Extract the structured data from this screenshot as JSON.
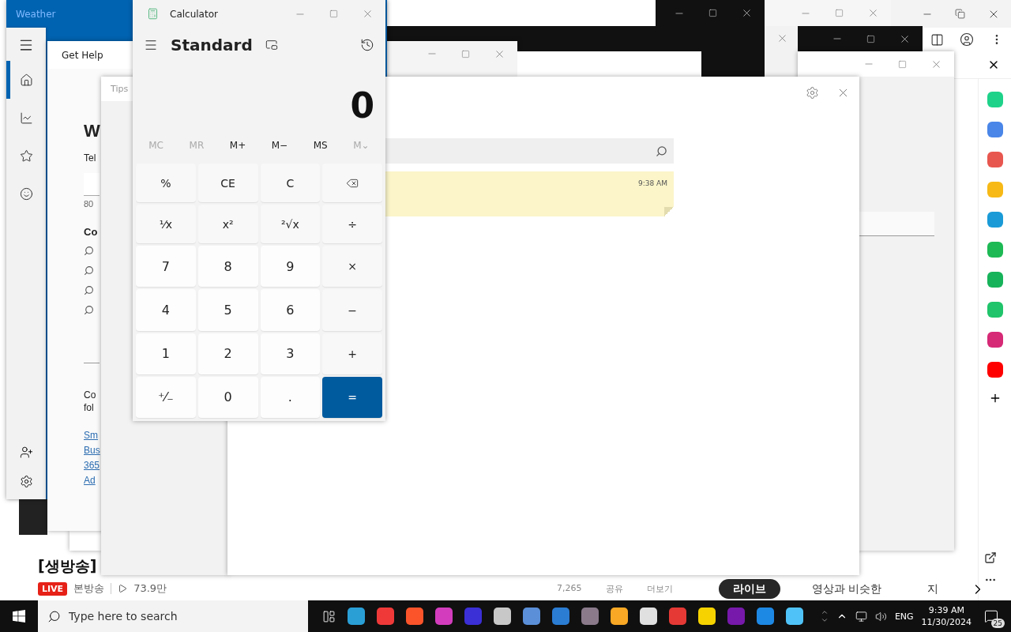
{
  "browser": {
    "video_title": "[생방송]",
    "live_badge": "LIVE",
    "channel": "본방송",
    "views": "73.9만",
    "likes": "7,265",
    "share": "공유",
    "more": "더보기",
    "chips": [
      {
        "label": "라이브",
        "selected": true
      },
      {
        "label": "영상과 비슷한",
        "selected": false
      },
      {
        "label": "지",
        "selected": false
      }
    ],
    "sidebar_apps": [
      {
        "color": "#1ed28a"
      },
      {
        "color": "#4a86e8"
      },
      {
        "color": "#e8574f"
      },
      {
        "color": "#f7b916"
      },
      {
        "color": "#1a9bd7"
      },
      {
        "color": "#1db954"
      },
      {
        "color": "#17b35a"
      },
      {
        "color": "#20c46a"
      },
      {
        "color": "#d62976"
      },
      {
        "color": "#ff0000"
      }
    ]
  },
  "weather": {
    "title": "Weather",
    "nav": [
      {
        "kind": "home",
        "selected": true
      },
      {
        "kind": "chart",
        "selected": false
      },
      {
        "kind": "favorites",
        "selected": false
      },
      {
        "kind": "smile",
        "selected": false
      }
    ],
    "footer": [
      {
        "kind": "account"
      },
      {
        "kind": "settings"
      }
    ]
  },
  "get_help": {
    "title": "Get Help",
    "heading": "W",
    "intro": "Tel",
    "count": "80",
    "section": "Co",
    "footer_text": [
      "Co",
      "fol"
    ],
    "links": [
      "Sm",
      "Bus",
      "365",
      "Ad"
    ]
  },
  "tips": {
    "title": "Tips"
  },
  "sticky_notes": {
    "note_time": "9:38 AM"
  },
  "calculator": {
    "title": "Calculator",
    "mode": "Standard",
    "display": "0",
    "memory": [
      {
        "label": "MC",
        "disabled": true
      },
      {
        "label": "MR",
        "disabled": true
      },
      {
        "label": "M+",
        "disabled": false
      },
      {
        "label": "M−",
        "disabled": false
      },
      {
        "label": "MS",
        "disabled": false
      },
      {
        "label": "M⌄",
        "disabled": true
      }
    ],
    "keys": [
      {
        "label": "%",
        "kind": "fn"
      },
      {
        "label": "CE",
        "kind": "fn"
      },
      {
        "label": "C",
        "kind": "fn"
      },
      {
        "kind": "backspace"
      },
      {
        "label": "¹⁄x",
        "kind": "fn"
      },
      {
        "label": "x²",
        "kind": "fn"
      },
      {
        "label": "²√x",
        "kind": "fn"
      },
      {
        "label": "÷",
        "kind": "fn"
      },
      {
        "label": "7",
        "kind": "num"
      },
      {
        "label": "8",
        "kind": "num"
      },
      {
        "label": "9",
        "kind": "num"
      },
      {
        "label": "×",
        "kind": "fn"
      },
      {
        "label": "4",
        "kind": "num"
      },
      {
        "label": "5",
        "kind": "num"
      },
      {
        "label": "6",
        "kind": "num"
      },
      {
        "label": "−",
        "kind": "fn"
      },
      {
        "label": "1",
        "kind": "num"
      },
      {
        "label": "2",
        "kind": "num"
      },
      {
        "label": "3",
        "kind": "num"
      },
      {
        "label": "+",
        "kind": "fn"
      },
      {
        "label": "⁺⁄₋",
        "kind": "num"
      },
      {
        "label": "0",
        "kind": "num"
      },
      {
        "label": ".",
        "kind": "num"
      },
      {
        "label": "=",
        "kind": "equals"
      }
    ]
  },
  "taskbar": {
    "search_placeholder": "Type here to search",
    "apps": [
      {
        "color": "#2a9fd6"
      },
      {
        "color": "#ef3939"
      },
      {
        "color": "#fb542b"
      },
      {
        "color": "#d33dbd"
      },
      {
        "color": "#3b2fd6"
      },
      {
        "color": "#c8c8c8"
      },
      {
        "color": "#5b8fd8"
      },
      {
        "color": "#2b7cd3"
      },
      {
        "color": "#8a7a8a"
      },
      {
        "color": "#f9a825"
      },
      {
        "color": "#e0e0e0"
      },
      {
        "color": "#e53935"
      },
      {
        "color": "#f6d300"
      },
      {
        "color": "#7719aa"
      },
      {
        "color": "#1e88e5"
      },
      {
        "color": "#4fc3f7"
      }
    ],
    "language": "ENG",
    "time": "9:39 AM",
    "date": "11/30/2024",
    "notifications": "25"
  }
}
